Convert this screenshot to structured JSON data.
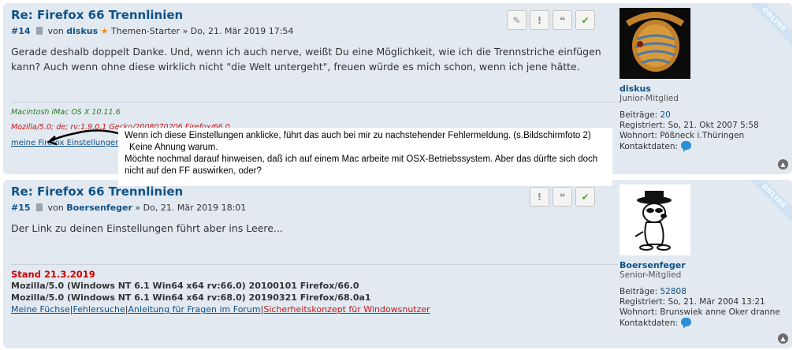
{
  "posts": [
    {
      "title": "Re: Firefox 66 Trennlinien",
      "number": "#14",
      "by": "von",
      "author": "diskus",
      "author_badge": "Themen-Starter",
      "date": "» Do, 21. Mär 2019 17:54",
      "content": "Gerade deshalb doppelt Danke. Und, wenn ich auch nerve, weißt Du eine Möglichkeit, wie ich die Trennstriche einfügen kann? Auch wenn ohne diese wirklich nicht \"die Welt untergeht\", freuen würde es mich schon, wenn ich jene hätte.",
      "signature": {
        "line1": "Macintosh iMac OS X 10.11.6",
        "line2": "Mozilla/5.0; de; rv:1.9.0.1 Gecko/2008070206 Firefox/66.0.",
        "link": "meine Firefox Einstellungen"
      },
      "profile": {
        "username": "diskus",
        "rank": "Junior-Mitglied",
        "posts_label": "Beiträge:",
        "posts_value": "20",
        "registered_label": "Registriert:",
        "registered_value": "So, 21. Okt 2007 5:58",
        "location_label": "Wohnort:",
        "location_value": "Pößneck i.Thüringen",
        "contact_label": "Kontaktdaten:",
        "status": "ONLINE"
      }
    },
    {
      "title": "Re: Firefox 66 Trennlinien",
      "number": "#15",
      "by": "von",
      "author": "Boersenfeger",
      "date": "» Do, 21. Mär 2019 18:01",
      "content": "Der Link zu deinen Einstellungen führt aber ins Leere...",
      "signature": {
        "stand": "Stand 21.3.2019",
        "ua1": "Mozilla/5.0 (Windows NT 6.1 Win64 x64 rv:66.0) 20100101 Firefox/66.0",
        "ua2": "Mozilla/5.0 (Windows NT 6.1 Win64 x64 rv:68.0) 20190321 Firefox/68.0a1",
        "links": [
          "Meine Füchse",
          "Fehlersuche",
          "Anleitung für Fragen im Forum",
          "Sicherheitskonzept für Windowsnutzer"
        ],
        "separator": "|"
      },
      "profile": {
        "username": "Boersenfeger",
        "rank": "Senior-Mitglied",
        "posts_label": "Beiträge:",
        "posts_value": "52808",
        "registered_label": "Registriert:",
        "registered_value": "So, 21. Mär 2004 13:21",
        "location_label": "Wohnort:",
        "location_value": "Brunswiek anne Oker dranne",
        "contact_label": "Kontaktdaten:",
        "status": "ONLINE"
      }
    }
  ],
  "annotation": {
    "line1": "Wenn ich diese Einstellungen anklicke, führt das auch bei mir zu nachstehender Fehlermeldung. (s.Bildschirmfoto 2)",
    "line2": "Keine Ahnung warum.",
    "line3": "Möchte nochmal darauf hinweisen, daß ich auf einem Mac arbeite mit OSX-Betriebssystem. Aber das dürfte sich doch",
    "line4": "nicht auf den FF auswirken, oder?"
  },
  "icons": {
    "edit": "pencil-icon",
    "report": "exclamation-icon",
    "quote": "quote-icon",
    "accept": "checkmark-icon",
    "top": "chevron-up-icon",
    "contact": "chat-bubble-icon"
  },
  "colors": {
    "post_bg": "#e2e9f0",
    "link": "#105289",
    "signature_red": "#c01818",
    "signature_green": "#2c7a23",
    "accept_green": "#4ea92b"
  }
}
